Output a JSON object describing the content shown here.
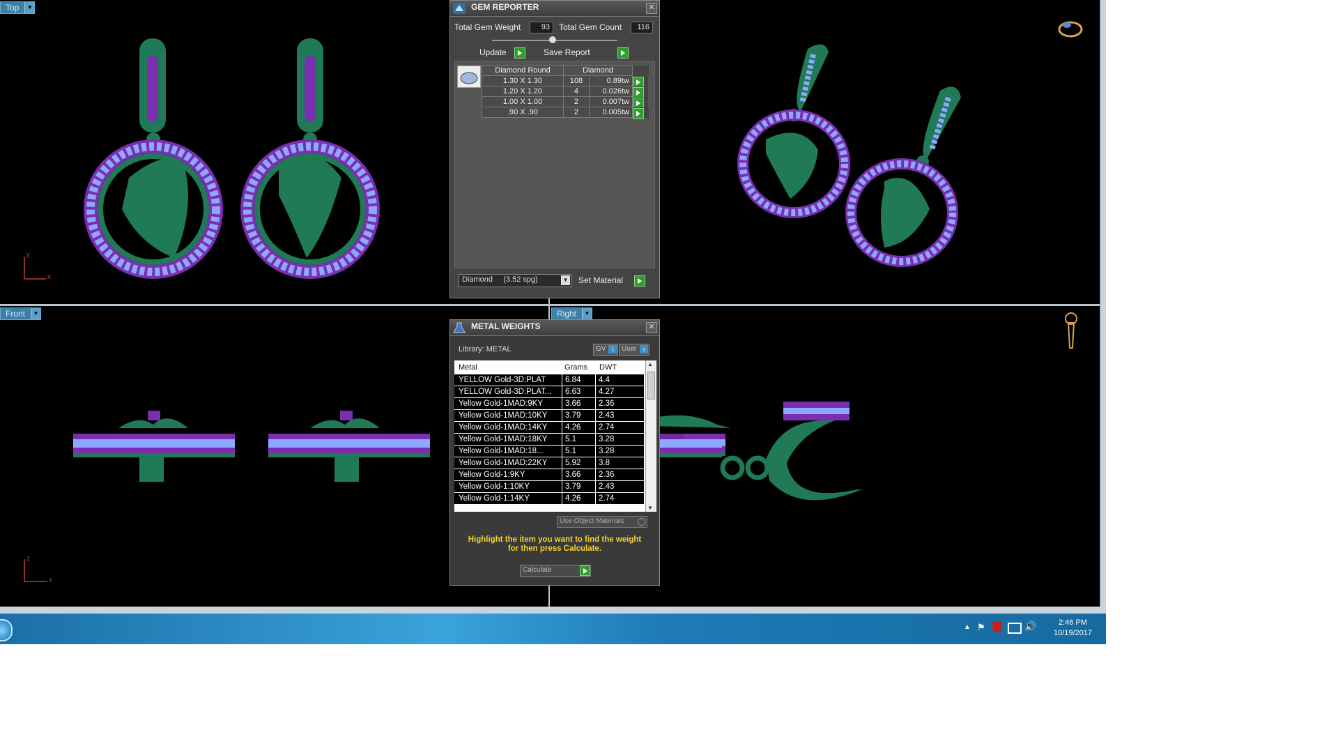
{
  "viewports": {
    "top_label": "Top",
    "front_label": "Front",
    "right_label": "Right",
    "axis_x": "x",
    "axis_y": "y",
    "axis_z": "z"
  },
  "gem_reporter": {
    "title": "GEM REPORTER",
    "total_weight_label": "Total Gem Weight",
    "total_weight_value": "93",
    "total_count_label": "Total Gem Count",
    "total_count_value": "116",
    "update_label": "Update",
    "save_report_label": "Save Report",
    "table_header_shape": "Diamond Round",
    "table_header_material": "Diamond",
    "rows": [
      {
        "size": "1.30 X 1.30",
        "count": "108",
        "weight": "0.89tw"
      },
      {
        "size": "1.20 X 1.20",
        "count": "4",
        "weight": "0.026tw"
      },
      {
        "size": "1.00 X 1.00",
        "count": "2",
        "weight": "0.007tw"
      },
      {
        "size": ".90 X .90",
        "count": "2",
        "weight": "0.005tw"
      }
    ],
    "material_select": "Diamond     (3.52 spg)",
    "set_material_label": "Set Material"
  },
  "metal_weights": {
    "title": "METAL WEIGHTS",
    "library_label": "Library: METAL",
    "gv_label": "GV",
    "user_label": "User",
    "col_metal": "Metal",
    "col_grams": "Grams",
    "col_dwt": "DWT",
    "rows": [
      {
        "metal": "YELLOW Gold-3D:PLAT",
        "grams": "6.84",
        "dwt": "4.4"
      },
      {
        "metal": "YELLOW Gold-3D:PLAT...",
        "grams": "6.63",
        "dwt": "4.27"
      },
      {
        "metal": "Yellow Gold-1MAD:9KY",
        "grams": "3.66",
        "dwt": "2.36"
      },
      {
        "metal": "Yellow Gold-1MAD:10KY",
        "grams": "3.79",
        "dwt": "2.43"
      },
      {
        "metal": "Yellow Gold-1MAD:14KY",
        "grams": "4.26",
        "dwt": "2.74"
      },
      {
        "metal": "Yellow Gold-1MAD:18KY",
        "grams": "5.1",
        "dwt": "3.28"
      },
      {
        "metal": "Yellow Gold-1MAD:18...",
        "grams": "5.1",
        "dwt": "3.28"
      },
      {
        "metal": "Yellow Gold-1MAD:22KY",
        "grams": "5.92",
        "dwt": "3.8"
      },
      {
        "metal": "Yellow Gold-1:9KY",
        "grams": "3.66",
        "dwt": "2.36"
      },
      {
        "metal": "Yellow Gold-1:10KY",
        "grams": "3.79",
        "dwt": "2.43"
      },
      {
        "metal": "Yellow Gold-1:14KY",
        "grams": "4.26",
        "dwt": "2.74"
      }
    ],
    "use_object_materials_label": "Use Object Materials",
    "hint_line1": "Highlight the item you want to find the weight",
    "hint_line2": "for then press Calculate.",
    "calculate_label": "Calculate"
  },
  "taskbar": {
    "time": "2:46 PM",
    "date": "10/19/2017"
  },
  "colors": {
    "metal": "#1f7a55",
    "gem_light": "#8ea8ff",
    "gem_dark": "#7a2fb0",
    "viewport_bg": "#000000"
  }
}
